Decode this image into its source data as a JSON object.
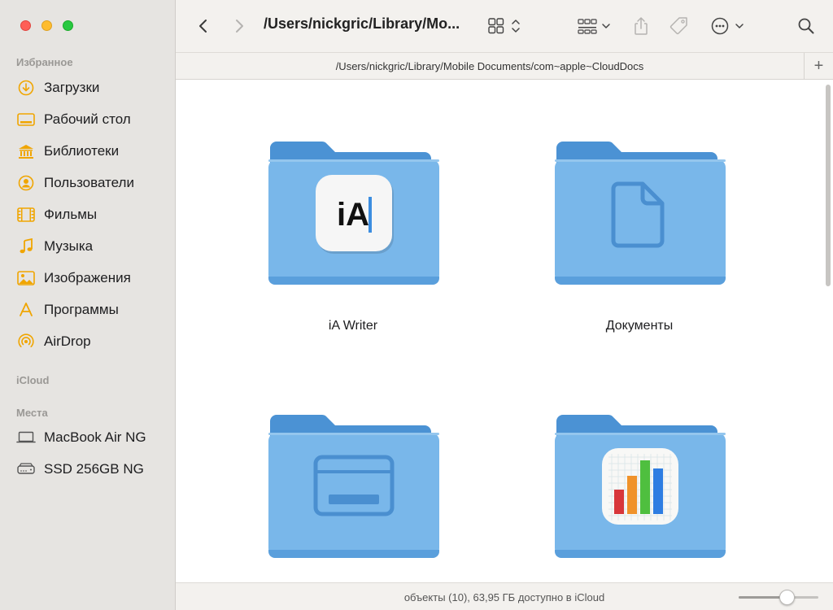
{
  "window": {
    "title": "/Users/nickgric/Library/Mo...",
    "path": "/Users/nickgric/Library/Mobile Documents/com~apple~CloudDocs"
  },
  "sidebar": {
    "sections": [
      {
        "title": "Избранное"
      },
      {
        "title": "iCloud"
      },
      {
        "title": "Места"
      }
    ],
    "favorites": [
      {
        "label": "Загрузки",
        "icon": "download-icon"
      },
      {
        "label": "Рабочий стол",
        "icon": "desktop-icon"
      },
      {
        "label": "Библиотеки",
        "icon": "library-icon"
      },
      {
        "label": "Пользователи",
        "icon": "user-icon"
      },
      {
        "label": "Фильмы",
        "icon": "film-icon"
      },
      {
        "label": "Музыка",
        "icon": "music-icon"
      },
      {
        "label": "Изображения",
        "icon": "photo-icon"
      },
      {
        "label": "Программы",
        "icon": "apps-icon"
      },
      {
        "label": "AirDrop",
        "icon": "airdrop-icon"
      }
    ],
    "places": [
      {
        "label": "MacBook Air NG",
        "icon": "laptop-icon"
      },
      {
        "label": "SSD 256GB NG",
        "icon": "disk-icon"
      }
    ]
  },
  "content": {
    "items": [
      {
        "label": "iA Writer",
        "icon": "ia-writer-folder-icon"
      },
      {
        "label": "Документы",
        "icon": "documents-folder-icon"
      },
      {
        "label": "",
        "icon": "window-folder-icon"
      },
      {
        "label": "",
        "icon": "numbers-folder-icon"
      }
    ],
    "ia_text": "iA"
  },
  "statusbar": {
    "text": "объекты (10), 63,95 ГБ доступно в iCloud",
    "zoom_level": 0.6
  },
  "colors": {
    "accent": "#f0a500",
    "folder_light": "#79b7ea",
    "folder_dark": "#4b92d4"
  }
}
